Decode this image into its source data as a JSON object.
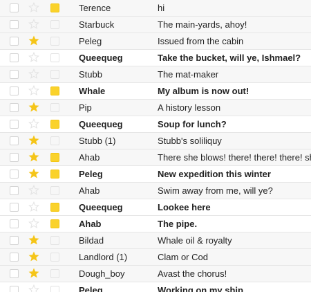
{
  "colors": {
    "star_on": "#f5c518",
    "star_off": "#e2e2e2",
    "label_yellow": "#fad22b"
  },
  "messages": [
    {
      "sender": "Terence",
      "subject": "hi",
      "starred": false,
      "labeled": true,
      "unread": false
    },
    {
      "sender": "Starbuck",
      "subject": "The main-yards, ahoy!",
      "starred": false,
      "labeled": false,
      "unread": false
    },
    {
      "sender": "Peleg",
      "subject": "Issued from the cabin",
      "starred": true,
      "labeled": false,
      "unread": false
    },
    {
      "sender": "Queequeg",
      "subject": "Take the bucket, will ye, Ishmael?",
      "starred": false,
      "labeled": false,
      "unread": true
    },
    {
      "sender": "Stubb",
      "subject": "The mat-maker",
      "starred": false,
      "labeled": false,
      "unread": false
    },
    {
      "sender": "Whale",
      "subject": "My album is now out!",
      "starred": false,
      "labeled": true,
      "unread": true
    },
    {
      "sender": "Pip",
      "subject": "A history lesson",
      "starred": true,
      "labeled": false,
      "unread": false
    },
    {
      "sender": "Queequeg",
      "subject": "Soup for lunch?",
      "starred": false,
      "labeled": true,
      "unread": true
    },
    {
      "sender": "Stubb (1)",
      "subject": "Stubb's soliliquy",
      "starred": true,
      "labeled": false,
      "unread": false
    },
    {
      "sender": "Ahab",
      "subject": "There she blows! there! there! there! she blows!",
      "starred": true,
      "labeled": true,
      "unread": false
    },
    {
      "sender": "Peleg",
      "subject": "New expedition this winter",
      "starred": true,
      "labeled": true,
      "unread": true
    },
    {
      "sender": "Ahab",
      "subject": "Swim away from me, will ye?",
      "starred": false,
      "labeled": false,
      "unread": false
    },
    {
      "sender": "Queequeg",
      "subject": "Lookee here",
      "starred": false,
      "labeled": true,
      "unread": true
    },
    {
      "sender": "Ahab",
      "subject": "The pipe.",
      "starred": false,
      "labeled": true,
      "unread": true
    },
    {
      "sender": "Bildad",
      "subject": "Whale oil & royalty",
      "starred": true,
      "labeled": false,
      "unread": false
    },
    {
      "sender": "Landlord (1)",
      "subject": "Clam or Cod",
      "starred": true,
      "labeled": false,
      "unread": false
    },
    {
      "sender": "Dough_boy",
      "subject": "Avast the chorus!",
      "starred": true,
      "labeled": false,
      "unread": false
    },
    {
      "sender": "Peleg",
      "subject": "Working on my ship",
      "starred": false,
      "labeled": false,
      "unread": true
    }
  ]
}
